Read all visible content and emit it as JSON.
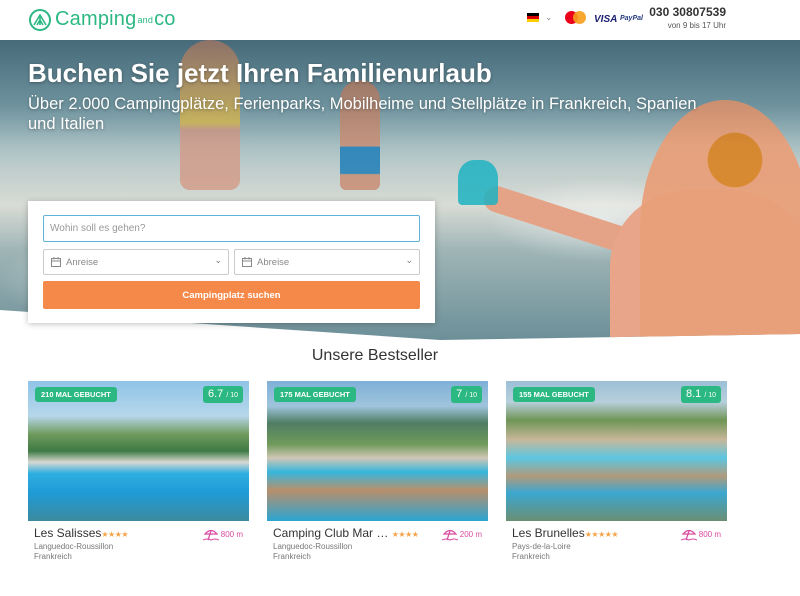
{
  "header": {
    "logo_text_main": "Camping",
    "logo_text_small": "and",
    "logo_text_end": "co",
    "language_flag": "german-flag",
    "payments": {
      "mastercard_label": "mastercard",
      "visa_label": "VISA",
      "paypal_label": "PayPal"
    },
    "phone": "030 30807539",
    "hours": "von 9 bis 17 Uhr"
  },
  "hero": {
    "title": "Buchen Sie jetzt Ihren Familienurlaub",
    "subtitle": "Über 2.000 Campingplätze, Ferienparks, Mobilheime und Stellplätze in Frankreich, Spanien und Italien"
  },
  "search": {
    "destination_placeholder": "Wohin soll es gehen?",
    "arrival_label": "Anreise",
    "departure_label": "Abreise",
    "button_label": "Campingplatz suchen"
  },
  "bestsellers": {
    "title": "Unsere Bestseller",
    "cards": [
      {
        "booked": "210 MAL GEBUCHT",
        "score": "6.7",
        "score_den": "/ 10",
        "name": "Les Salisses",
        "stars": "★★★★",
        "region": "Languedoc-Roussillon",
        "country": "Frankreich",
        "beach_distance": "800 m"
      },
      {
        "booked": "175 MAL GEBUCHT",
        "score": "7",
        "score_den": "/ 10",
        "name": "Camping Club Mar …",
        "stars": "★★★★",
        "region": "Languedoc-Roussillon",
        "country": "Frankreich",
        "beach_distance": "200 m"
      },
      {
        "booked": "155 MAL GEBUCHT",
        "score": "8.1",
        "score_den": "/ 10",
        "name": "Les Brunelles",
        "stars": "★★★★★",
        "region": "Pays-de-la-Loire",
        "country": "Frankreich",
        "beach_distance": "800 m"
      }
    ]
  },
  "colors": {
    "brand_green": "#2cb883",
    "cta_orange": "#f5894a",
    "beach_pink": "#d94ba0",
    "star_orange": "#f5a34a"
  }
}
